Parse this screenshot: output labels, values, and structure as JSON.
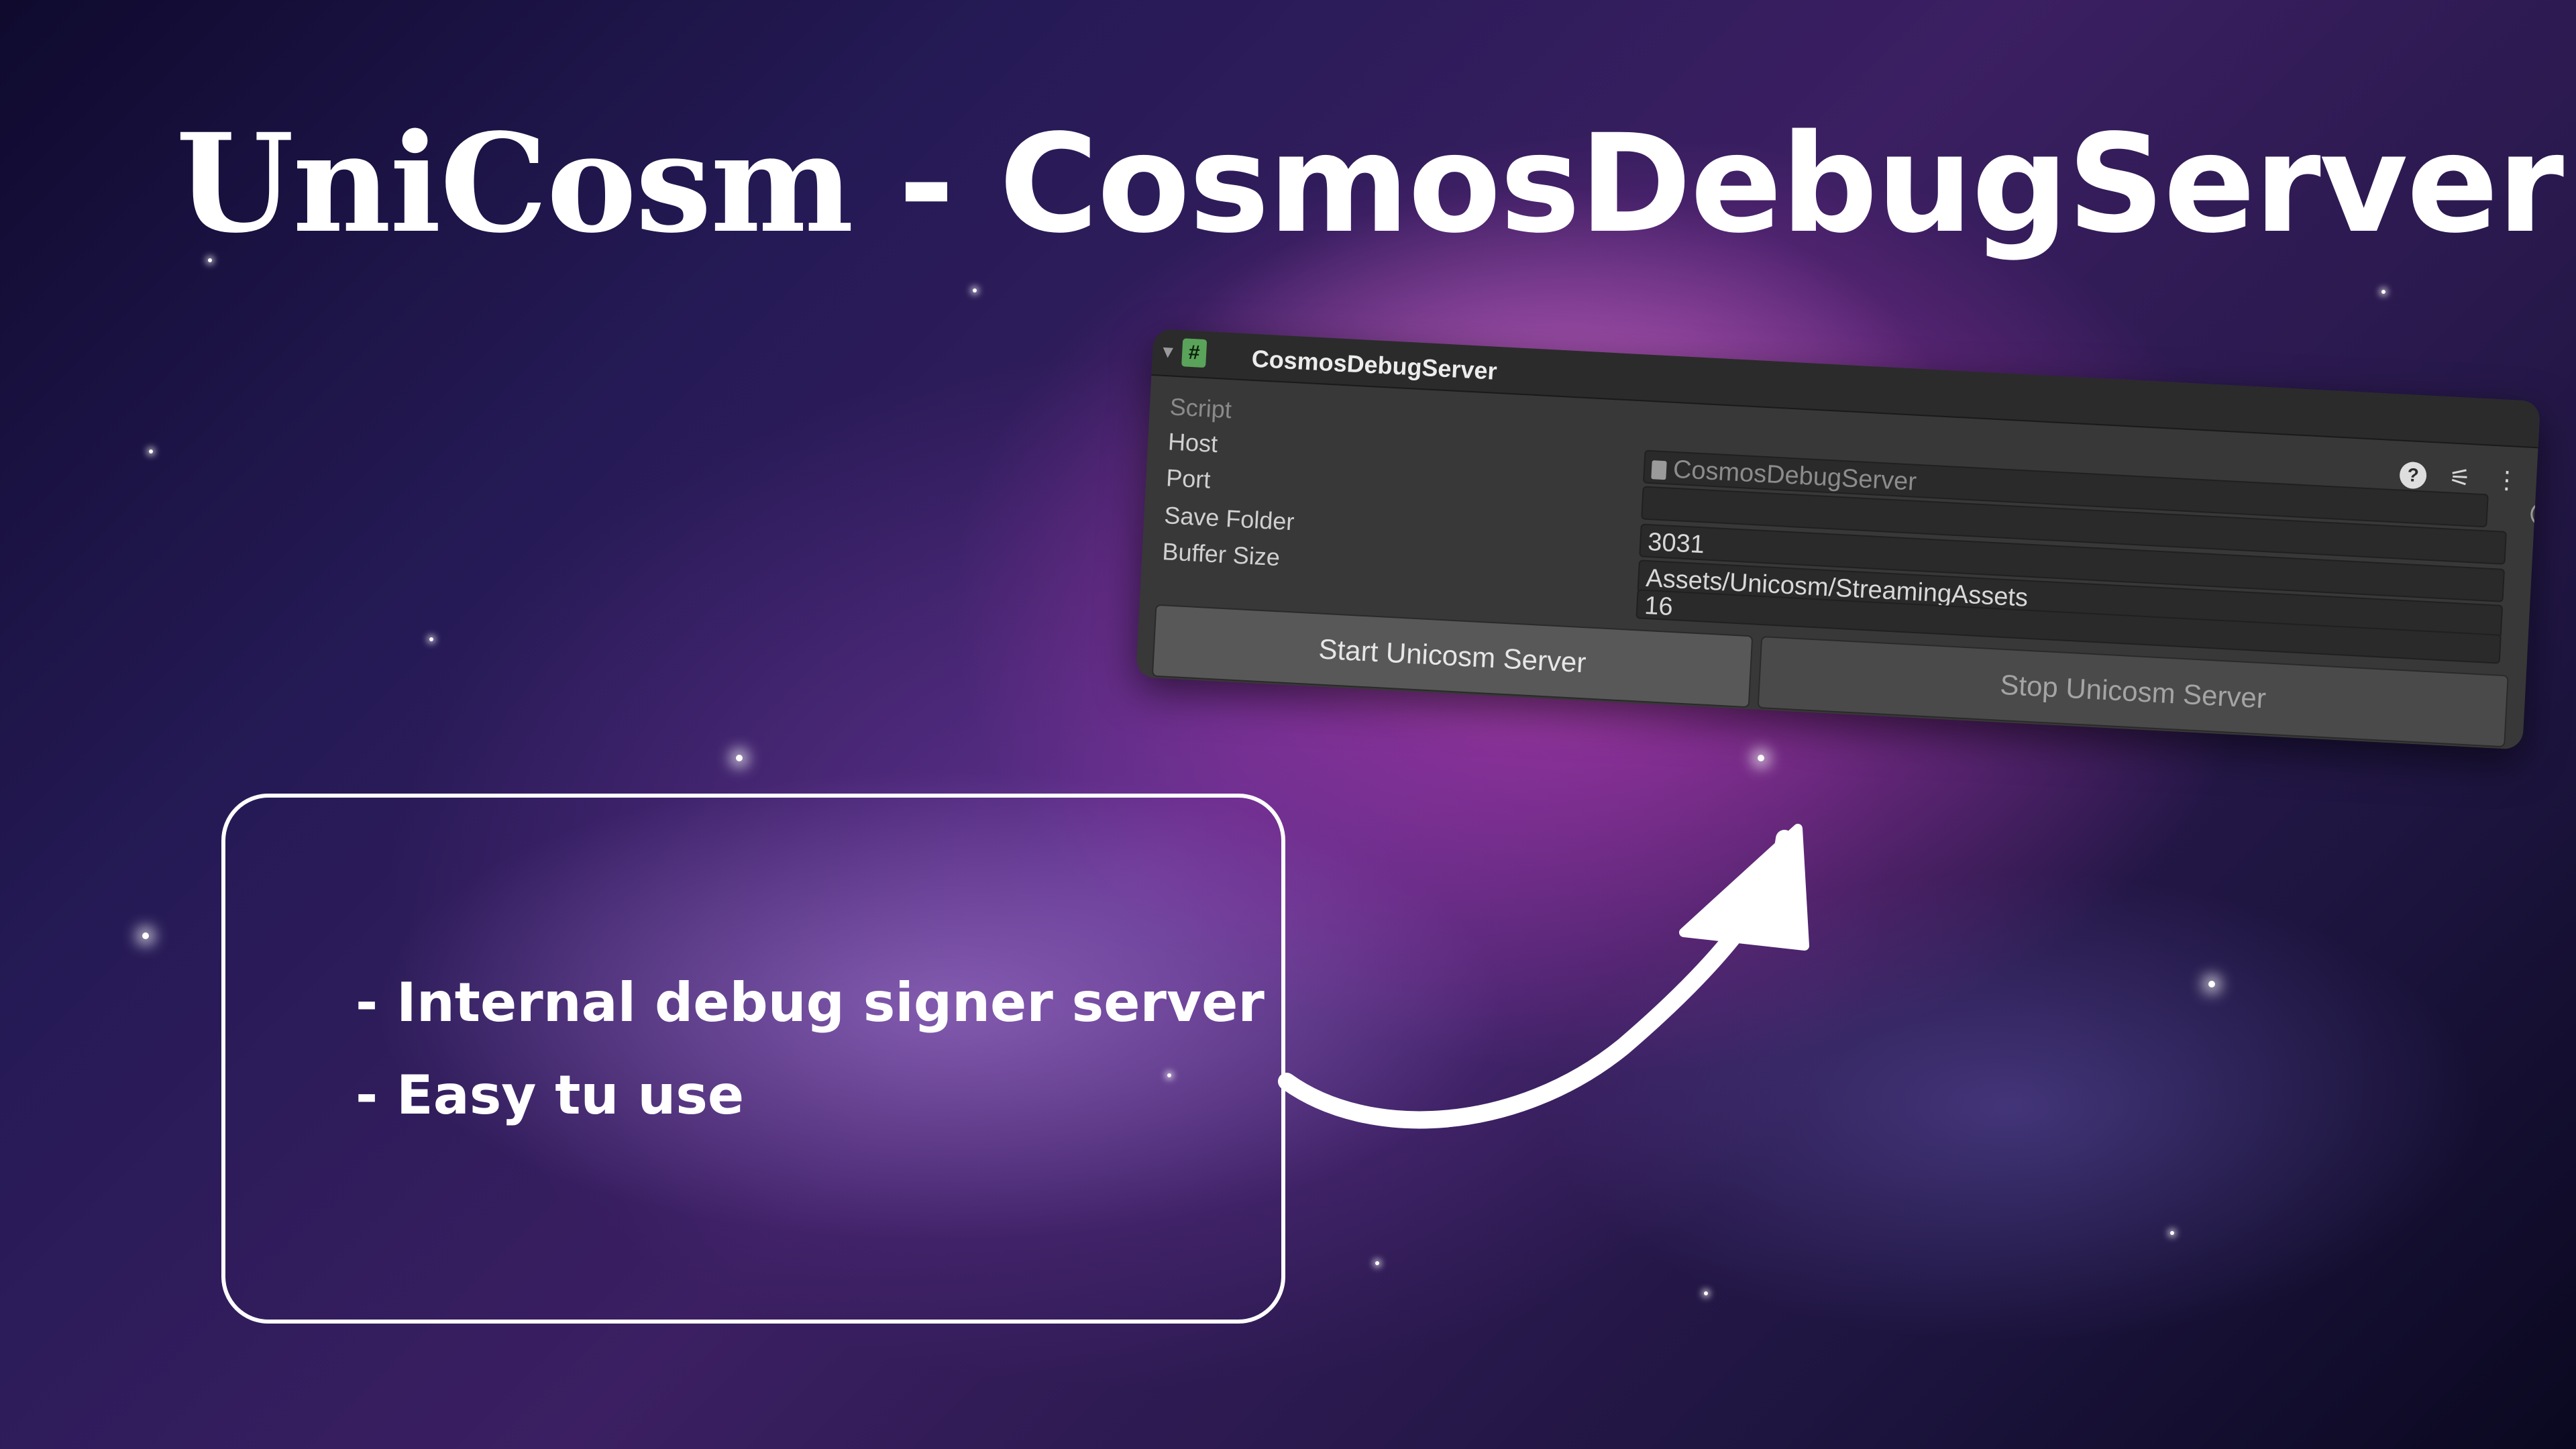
{
  "page": {
    "title_brand": "UniCosm",
    "title_rest": " - CosmosDebugServer"
  },
  "inspector": {
    "component_title": "CosmosDebugServer",
    "fields": [
      {
        "label": "Script",
        "value": "CosmosDebugServer"
      },
      {
        "label": "Host",
        "value": ""
      },
      {
        "label": "Port",
        "value": "3031"
      },
      {
        "label": "Save Folder",
        "value": "Assets/Unicosm/StreamingAssets"
      },
      {
        "label": "Buffer Size",
        "value": "16"
      }
    ],
    "buttons": {
      "start": "Start Unicosm Server",
      "stop": "Stop Unicosm Server"
    },
    "header_icons": [
      "help-icon",
      "preset-sliders-icon",
      "kebab-menu-icon"
    ]
  },
  "features": [
    "- Internal debug signer server",
    "- Easy tu use"
  ],
  "colors": {
    "panel_bg": "#383838",
    "header_bg": "#2b2b2b",
    "script_icon": "#5aa35a",
    "text": "#ffffff"
  }
}
